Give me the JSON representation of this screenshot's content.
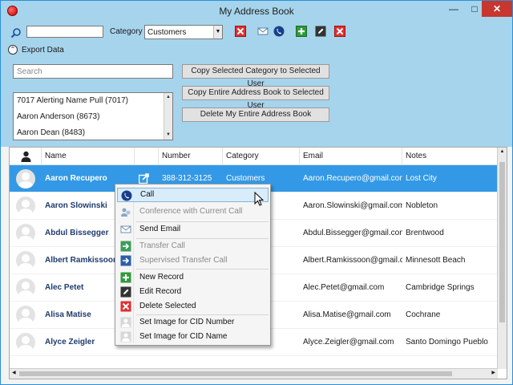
{
  "window": {
    "title": "My Address Book"
  },
  "toolbar": {
    "category_label": "Category",
    "category_value": "Customers",
    "export_label": "Export Data"
  },
  "export_panel": {
    "search_placeholder": "Search",
    "users": [
      "7017 Alerting Name Pull (7017)",
      "Aaron Anderson (8673)",
      "Aaron Dean (8483)"
    ],
    "buttons": {
      "copy_category": "Copy Selected Category to Selected User",
      "copy_all": "Copy Entire Address Book to Selected User",
      "delete_all": "Delete My Entire Address Book"
    }
  },
  "grid": {
    "columns": [
      "Name",
      "Number",
      "Category",
      "Email",
      "Notes"
    ],
    "rows": [
      {
        "name": "Aaron Recupero",
        "number": "388-312-3125",
        "category": "Customers",
        "email": "Aaron.Recupero@gmail.com",
        "notes": "Lost City"
      },
      {
        "name": "Aaron Slowinski",
        "number": "",
        "category": "",
        "email": "Aaron.Slowinski@gmail.com",
        "notes": "Nobleton"
      },
      {
        "name": "Abdul Bissegger",
        "number": "",
        "category": "",
        "email": "Abdul.Bissegger@gmail.com",
        "notes": "Brentwood"
      },
      {
        "name": "Albert Ramkissoon",
        "number": "",
        "category": "",
        "email": "Albert.Ramkissoon@gmail.c",
        "notes": "Minnesott Beach"
      },
      {
        "name": "Alec Petet",
        "number": "",
        "category": "",
        "email": "Alec.Petet@gmail.com",
        "notes": "Cambridge Springs"
      },
      {
        "name": "Alisa Matise",
        "number": "",
        "category": "",
        "email": "Alisa.Matise@gmail.com",
        "notes": "Cochrane"
      },
      {
        "name": "Alyce Zeigler",
        "number": "",
        "category": "",
        "email": "Alyce.Zeigler@gmail.com",
        "notes": "Santo Domingo Pueblo"
      }
    ]
  },
  "context_menu": {
    "items": [
      "Call",
      "Conference with Current Call",
      "Send Email",
      "Transfer Call",
      "Supervised Transfer Call",
      "New Record",
      "Edit Record",
      "Delete Selected",
      "Set Image for CID Number",
      "Set Image for CID Name"
    ]
  },
  "colors": {
    "accent": "#3399e6",
    "titlebar": "#a6d4ec",
    "close": "#c7372f"
  }
}
